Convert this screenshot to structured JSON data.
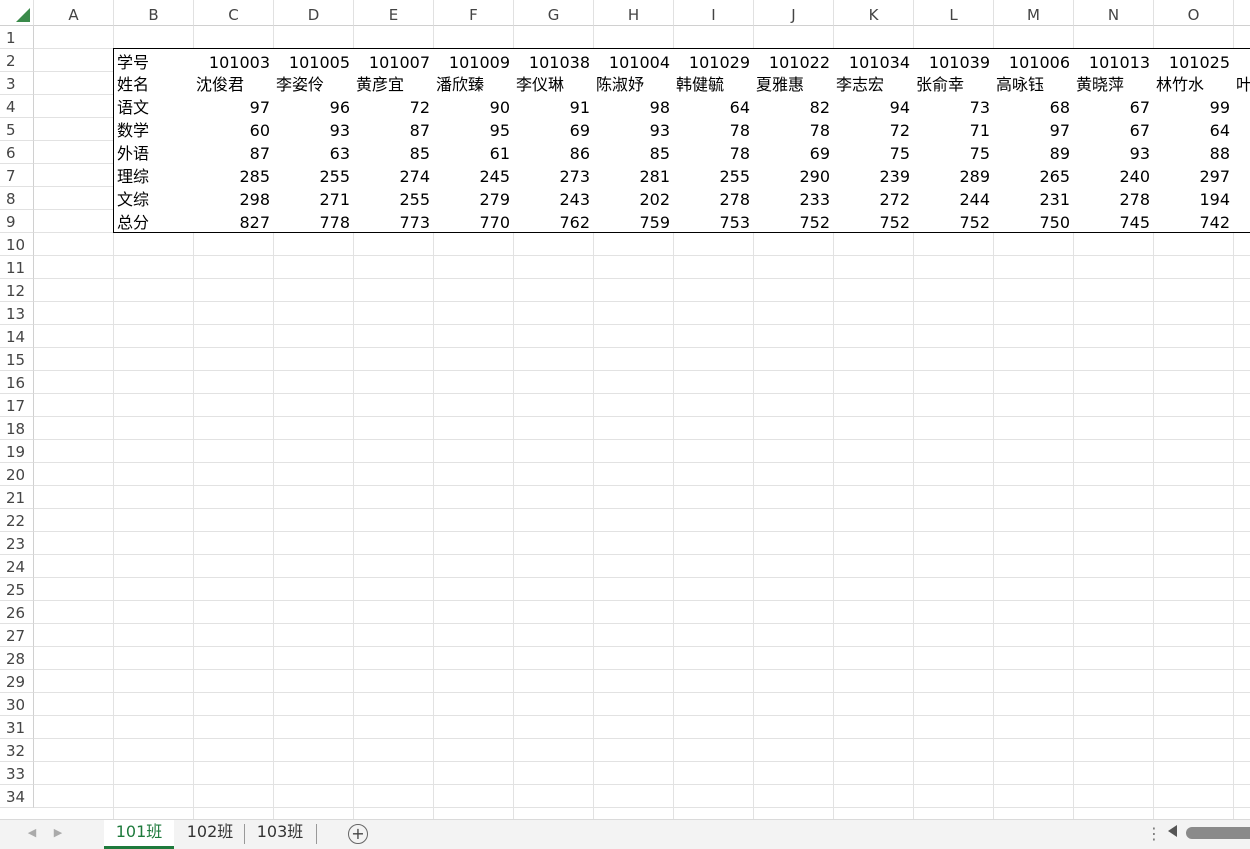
{
  "columns": [
    "A",
    "B",
    "C",
    "D",
    "E",
    "F",
    "G",
    "H",
    "I",
    "J",
    "K",
    "L",
    "M",
    "N",
    "O"
  ],
  "rows": [
    1,
    2,
    3,
    4,
    5,
    6,
    7,
    8,
    9,
    10,
    11,
    12,
    13,
    14,
    15,
    16,
    17,
    18,
    19,
    20,
    21,
    22,
    23,
    24,
    25,
    26,
    27,
    28,
    29,
    30,
    31,
    32,
    33,
    34
  ],
  "table": {
    "labels": [
      "学号",
      "姓名",
      "语文",
      "数学",
      "外语",
      "理综",
      "文综",
      "总分"
    ],
    "students": [
      {
        "id": "101003",
        "name": "沈俊君",
        "scores": [
          "97",
          "60",
          "87",
          "285",
          "298",
          "827"
        ]
      },
      {
        "id": "101005",
        "name": "李姿伶",
        "scores": [
          "96",
          "93",
          "63",
          "255",
          "271",
          "778"
        ]
      },
      {
        "id": "101007",
        "name": "黄彦宜",
        "scores": [
          "72",
          "87",
          "85",
          "274",
          "255",
          "773"
        ]
      },
      {
        "id": "101009",
        "name": "潘欣臻",
        "scores": [
          "90",
          "95",
          "61",
          "245",
          "279",
          "770"
        ]
      },
      {
        "id": "101038",
        "name": "李仪琳",
        "scores": [
          "91",
          "69",
          "86",
          "273",
          "243",
          "762"
        ]
      },
      {
        "id": "101004",
        "name": "陈淑妤",
        "scores": [
          "98",
          "93",
          "85",
          "281",
          "202",
          "759"
        ]
      },
      {
        "id": "101029",
        "name": "韩健毓",
        "scores": [
          "64",
          "78",
          "78",
          "255",
          "278",
          "753"
        ]
      },
      {
        "id": "101022",
        "name": "夏雅惠",
        "scores": [
          "82",
          "78",
          "69",
          "290",
          "233",
          "752"
        ]
      },
      {
        "id": "101034",
        "name": "李志宏",
        "scores": [
          "94",
          "72",
          "75",
          "239",
          "272",
          "752"
        ]
      },
      {
        "id": "101039",
        "name": "张俞幸",
        "scores": [
          "73",
          "71",
          "75",
          "289",
          "244",
          "752"
        ]
      },
      {
        "id": "101006",
        "name": "高咏钰",
        "scores": [
          "68",
          "97",
          "89",
          "265",
          "231",
          "750"
        ]
      },
      {
        "id": "101013",
        "name": "黄晓萍",
        "scores": [
          "67",
          "67",
          "93",
          "240",
          "278",
          "745"
        ]
      },
      {
        "id": "101025",
        "name": "林竹水",
        "scores": [
          "99",
          "64",
          "88",
          "297",
          "194",
          "742"
        ]
      }
    ],
    "partial_next_name": "叶"
  },
  "sheet_tabs": [
    {
      "label": "101班",
      "active": true
    },
    {
      "label": "102班",
      "active": false
    },
    {
      "label": "103班",
      "active": false
    }
  ],
  "icons": {
    "add_sheet": "+",
    "prev_sheet": "◀",
    "next_sheet": "▶",
    "more_options": "⋮"
  },
  "colors": {
    "accent": "#1e7a3c",
    "gridline": "#e2e2e2",
    "border": "#000000"
  }
}
